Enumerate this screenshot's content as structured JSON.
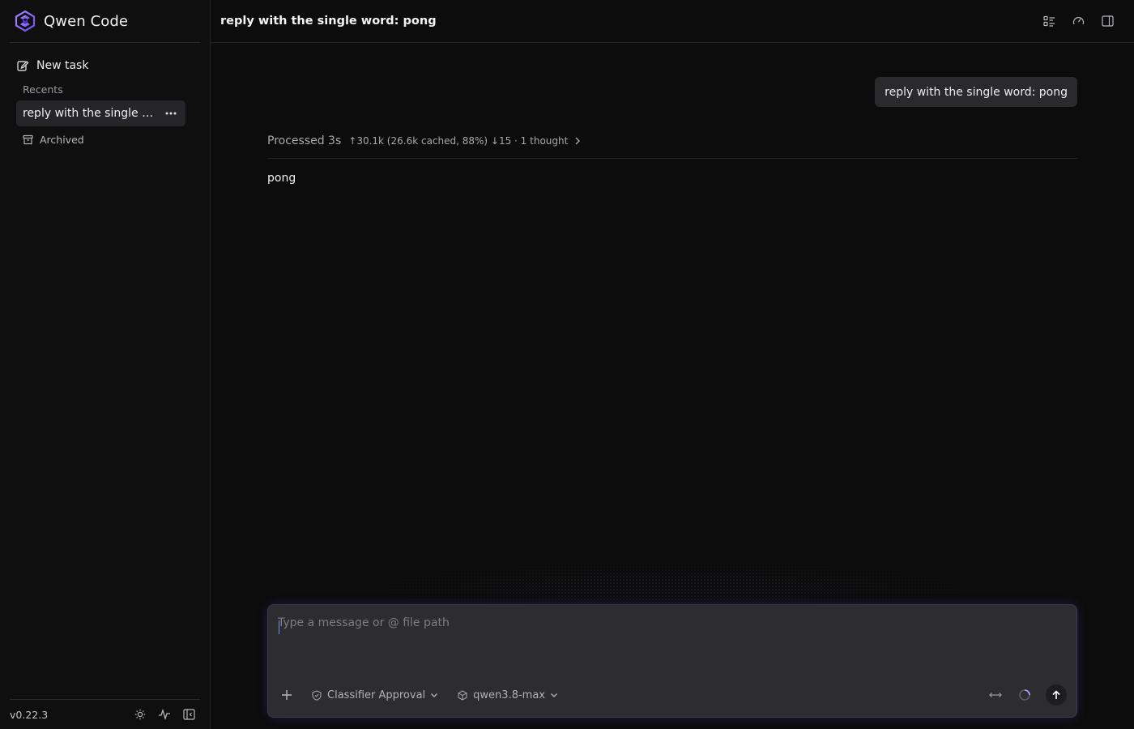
{
  "app": {
    "title": "Qwen Code",
    "version": "v0.22.3",
    "accent": "#7b5cf5"
  },
  "sidebar": {
    "new_task": "New task",
    "recents_label": "Recents",
    "recents": [
      {
        "label": "reply with the single word: pong"
      }
    ],
    "archived": "Archived"
  },
  "header": {
    "title": "reply with the single word: pong"
  },
  "chat": {
    "user_message": "reply with the single word: pong",
    "processed_label": "Processed 3s",
    "processed_stats": "↑30.1k (26.6k cached, 88%) ↓15 · 1 thought",
    "assistant_reply": "pong"
  },
  "composer": {
    "placeholder": "Type a message or @ file path",
    "approval_mode": "Classifier Approval",
    "model": "qwen3.8-max"
  },
  "icons": {
    "header": [
      "list-icon",
      "gauge-icon",
      "panel-icon"
    ],
    "footer": [
      "sun-icon",
      "activity-icon",
      "collapse-sidebar-icon"
    ]
  }
}
